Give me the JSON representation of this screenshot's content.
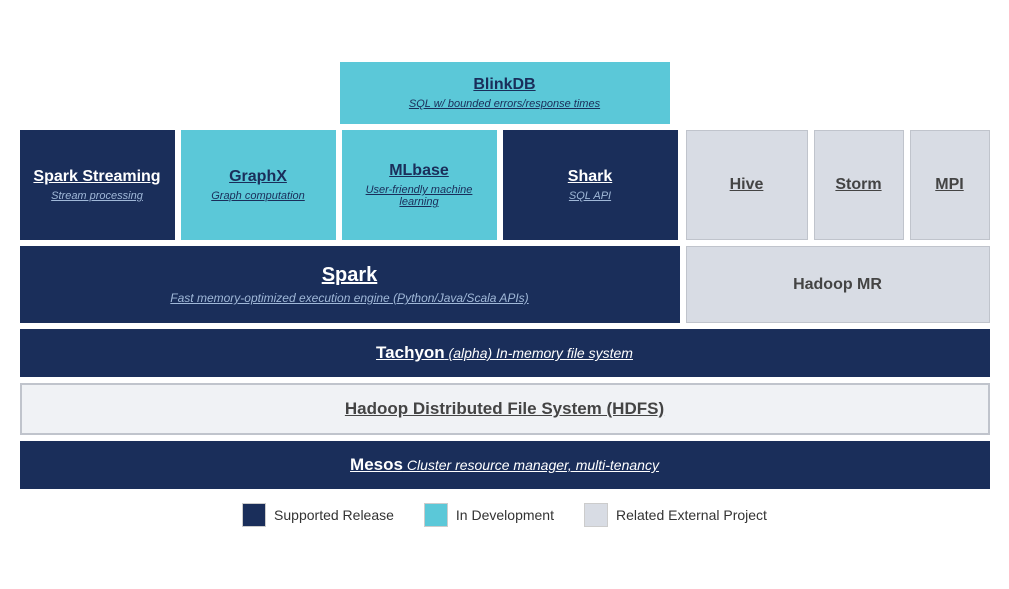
{
  "blinkdb": {
    "title": "BlinkDB",
    "subtitle": "SQL w/ bounded errors/response times"
  },
  "spark_streaming": {
    "title": "Spark Streaming",
    "subtitle": "Stream processing"
  },
  "graphx": {
    "title": "GraphX",
    "subtitle": "Graph computation"
  },
  "mlbase": {
    "title": "MLbase",
    "subtitle": "User-friendly machine learning"
  },
  "shark": {
    "title": "Shark",
    "subtitle": "SQL API"
  },
  "hive": {
    "title": "Hive"
  },
  "storm": {
    "title": "Storm"
  },
  "mpi": {
    "title": "MPI"
  },
  "spark": {
    "title": "Spark",
    "subtitle": "Fast memory-optimized execution engine (Python/Java/Scala APIs)"
  },
  "hadoop_mr": {
    "title": "Hadoop MR"
  },
  "tachyon": {
    "main": "Tachyon",
    "rest": " (alpha) In-memory file system"
  },
  "hdfs": {
    "title": "Hadoop Distributed File System (HDFS)"
  },
  "mesos": {
    "main": "Mesos",
    "rest": " Cluster resource manager, multi-tenancy"
  },
  "legend": {
    "supported": "Supported Release",
    "development": "In Development",
    "external": "Related External Project"
  }
}
